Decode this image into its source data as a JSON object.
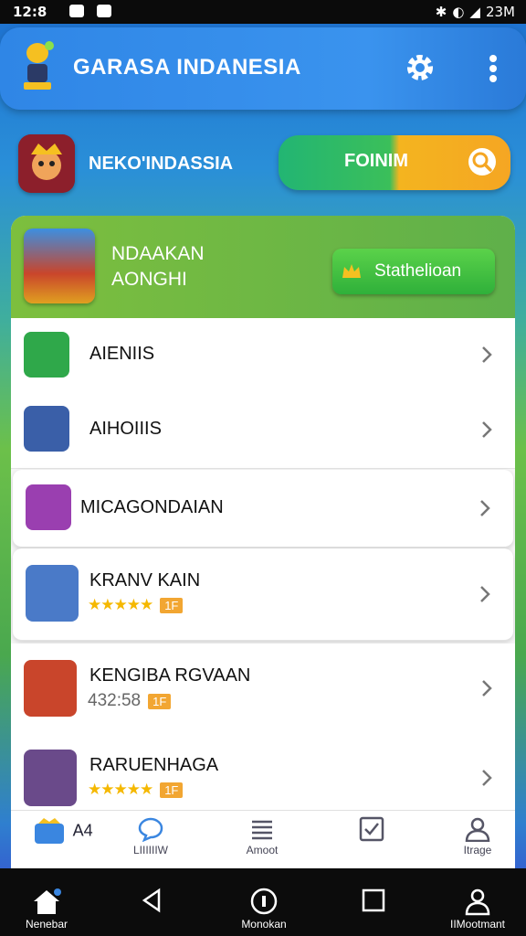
{
  "status_bar": {
    "time": "12:8",
    "right_text": "23M"
  },
  "header": {
    "title": "GARASA INDANESIA"
  },
  "profile": {
    "name": "NEKO'INDASSIA",
    "forum_label": "FOINIM"
  },
  "feature": {
    "title_line1": "NDAAKAN",
    "title_line2": "AONGHI",
    "button_label": "Stathelioan"
  },
  "list": [
    {
      "name": "AIENIIS"
    },
    {
      "name": "AIHOIIIS"
    },
    {
      "name": "MICAGONDAIAN"
    },
    {
      "name": "KRANV KAIN",
      "stars": "★★★★★",
      "badge": "1F"
    },
    {
      "name": "KENGIBA RGVAAN",
      "meta_text": "432:58",
      "badge": "1F"
    },
    {
      "name": "RARUENHAGA",
      "stars": "★★★★★",
      "badge": "1F"
    }
  ],
  "tabbar": {
    "first_label": "A4",
    "tabs": [
      {
        "label": "LIIIIIIW"
      },
      {
        "label": "Amoot"
      },
      {
        "label": ""
      },
      {
        "label": "Itrage"
      }
    ]
  },
  "system_nav": {
    "home": "Nenebar",
    "back": "",
    "recent": "Monokan",
    "square": "",
    "account": "IIMootmant"
  },
  "colors": {
    "accent_blue": "#2f86e6",
    "green": "#3bbf5a",
    "orange": "#f5a623"
  }
}
